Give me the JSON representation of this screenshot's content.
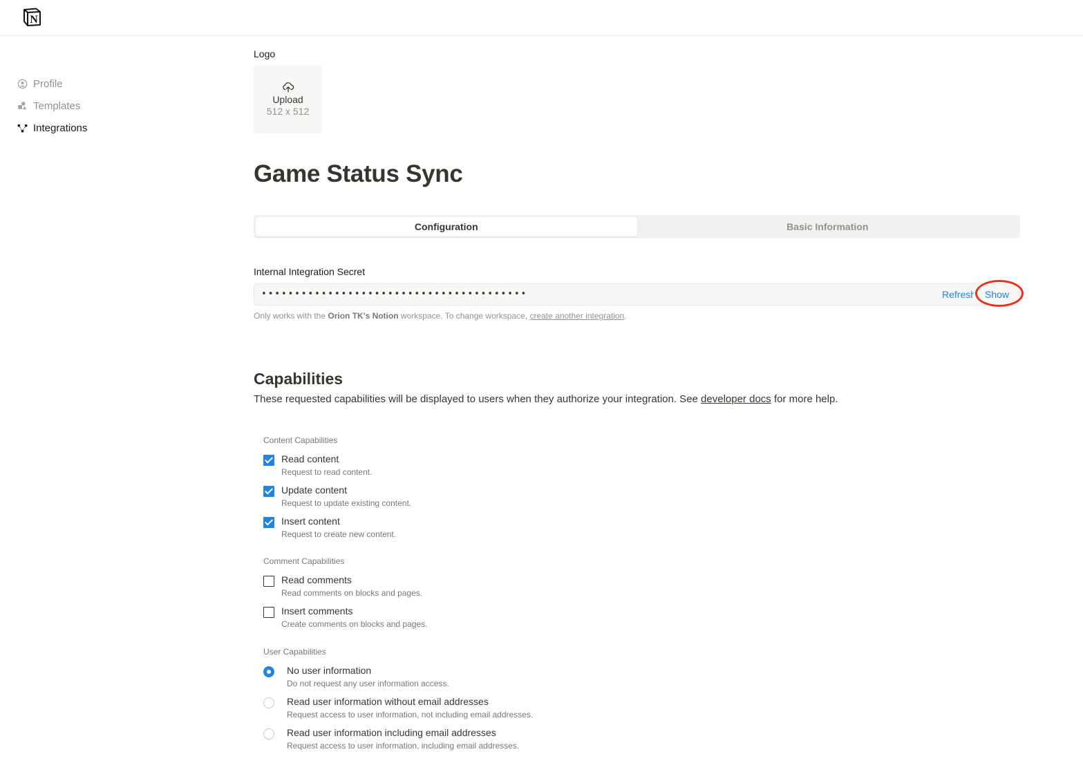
{
  "app": {
    "logo_letter": "N"
  },
  "sidebar": {
    "items": [
      {
        "label": "Profile",
        "icon": "profile-icon",
        "active": false
      },
      {
        "label": "Templates",
        "icon": "templates-icon",
        "active": false
      },
      {
        "label": "Integrations",
        "icon": "integrations-icon",
        "active": true
      }
    ]
  },
  "logo_section": {
    "label": "Logo",
    "upload_label": "Upload",
    "dimensions": "512 x 512"
  },
  "page": {
    "title": "Game Status Sync"
  },
  "tabs": [
    {
      "label": "Configuration",
      "active": true
    },
    {
      "label": "Basic Information",
      "active": false
    }
  ],
  "secret": {
    "label": "Internal Integration Secret",
    "masked_value": "••••••••••••••••••••••••••••••••••••••••",
    "refresh_label": "Refresh",
    "show_label": "Show",
    "help_prefix": "Only works with the ",
    "workspace_name": "Orion TK's Notion",
    "help_middle": " workspace. To change workspace, ",
    "help_link": "create another integration",
    "help_suffix": "."
  },
  "capabilities": {
    "title": "Capabilities",
    "desc_prefix": "These requested capabilities will be displayed to users when they authorize your integration. See ",
    "desc_link": "developer docs",
    "desc_suffix": " for more help.",
    "content": {
      "label": "Content Capabilities",
      "options": [
        {
          "title": "Read content",
          "sub": "Request to read content.",
          "checked": true
        },
        {
          "title": "Update content",
          "sub": "Request to update existing content.",
          "checked": true
        },
        {
          "title": "Insert content",
          "sub": "Request to create new content.",
          "checked": true
        }
      ]
    },
    "comment": {
      "label": "Comment Capabilities",
      "options": [
        {
          "title": "Read comments",
          "sub": "Read comments on blocks and pages.",
          "checked": false
        },
        {
          "title": "Insert comments",
          "sub": "Create comments on blocks and pages.",
          "checked": false
        }
      ]
    },
    "user": {
      "label": "User Capabilities",
      "options": [
        {
          "title": "No user information",
          "sub": "Do not request any user information access.",
          "selected": true
        },
        {
          "title": "Read user information without email addresses",
          "sub": "Request access to user information, not including email addresses.",
          "selected": false
        },
        {
          "title": "Read user information including email addresses",
          "sub": "Request access to user information, including email addresses.",
          "selected": false
        }
      ]
    }
  },
  "colors": {
    "accent": "#2383e2",
    "annotation": "#e8321f"
  }
}
